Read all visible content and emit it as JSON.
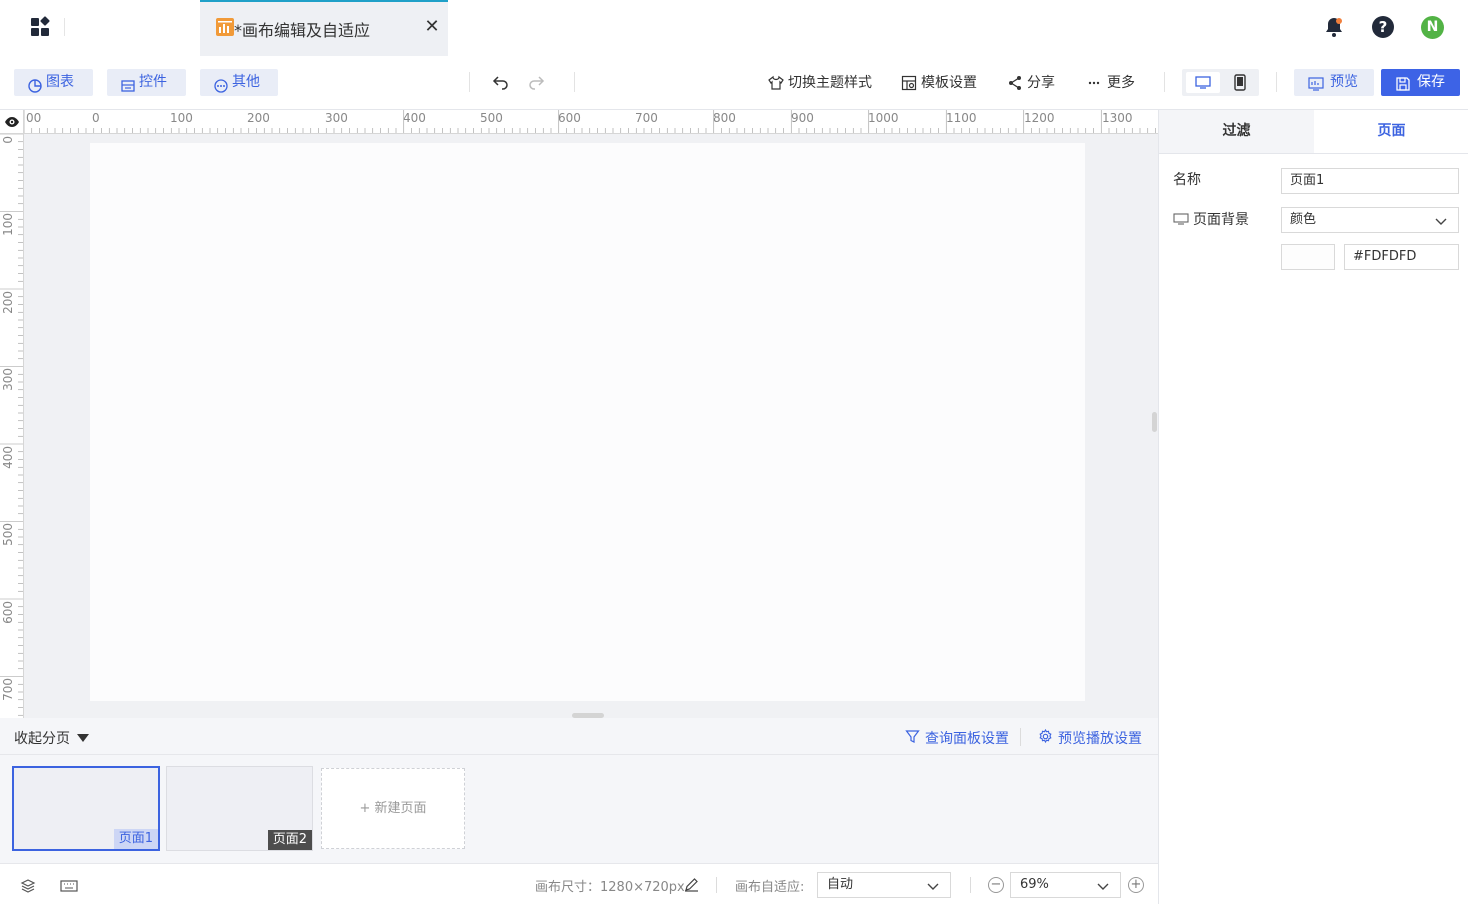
{
  "header": {
    "doc_tab_title": "*画布编辑及自适应",
    "close_glyph": "✕",
    "avatar_initial": "N",
    "help_glyph": "?"
  },
  "toolbar": {
    "chart_label": "图表",
    "control_label": "控件",
    "other_label": "其他",
    "theme_label": "切换主题样式",
    "template_label": "模板设置",
    "share_label": "分享",
    "more_label": "更多",
    "preview_label": "预览",
    "save_label": "保存"
  },
  "ruler": {
    "top_ticks": [
      "00",
      "0",
      "100",
      "200",
      "300",
      "400",
      "500",
      "600",
      "700",
      "800",
      "900",
      "1000",
      "1100",
      "1200",
      "1300"
    ],
    "left_ticks": [
      "0",
      "100",
      "200",
      "300",
      "400",
      "500",
      "600",
      "700"
    ]
  },
  "pages": {
    "collapse_label": "收起分页",
    "query_panel_label": "查询面板设置",
    "playback_label": "预览播放设置",
    "items": [
      {
        "label": "页面1",
        "active": true
      },
      {
        "label": "页面2",
        "active": false
      }
    ],
    "new_page_label": "+ 新建页面"
  },
  "status": {
    "canvas_size_label": "画布尺寸：1280×720px",
    "fit_label": "画布自适应:",
    "fit_value": "自动",
    "zoom_value": "69%"
  },
  "right_panel": {
    "tab_filter": "过滤",
    "tab_page": "页面",
    "name_label": "名称",
    "name_value": "页面1",
    "bg_label": "页面背景",
    "bg_type": "颜色",
    "bg_color": "#FDFDFD"
  },
  "colors": {
    "accent": "#3c63e0",
    "tab_accent": "#1fa0c8",
    "avatar": "#52b345",
    "doc_icon": "#f19a38"
  },
  "icons": [
    "apps-icon",
    "bell-icon",
    "help-icon",
    "chart-icon",
    "control-icon",
    "other-icon",
    "undo-icon",
    "redo-icon",
    "theme-icon",
    "template-icon",
    "share-icon",
    "more-icon",
    "desktop-icon",
    "mobile-icon",
    "preview-icon",
    "save-icon",
    "eye-icon",
    "filter-icon",
    "gear-icon",
    "layers-icon",
    "keyboard-icon",
    "edit-icon",
    "chevron-down-icon",
    "zoom-out-icon",
    "zoom-in-icon",
    "monitor-icon"
  ]
}
